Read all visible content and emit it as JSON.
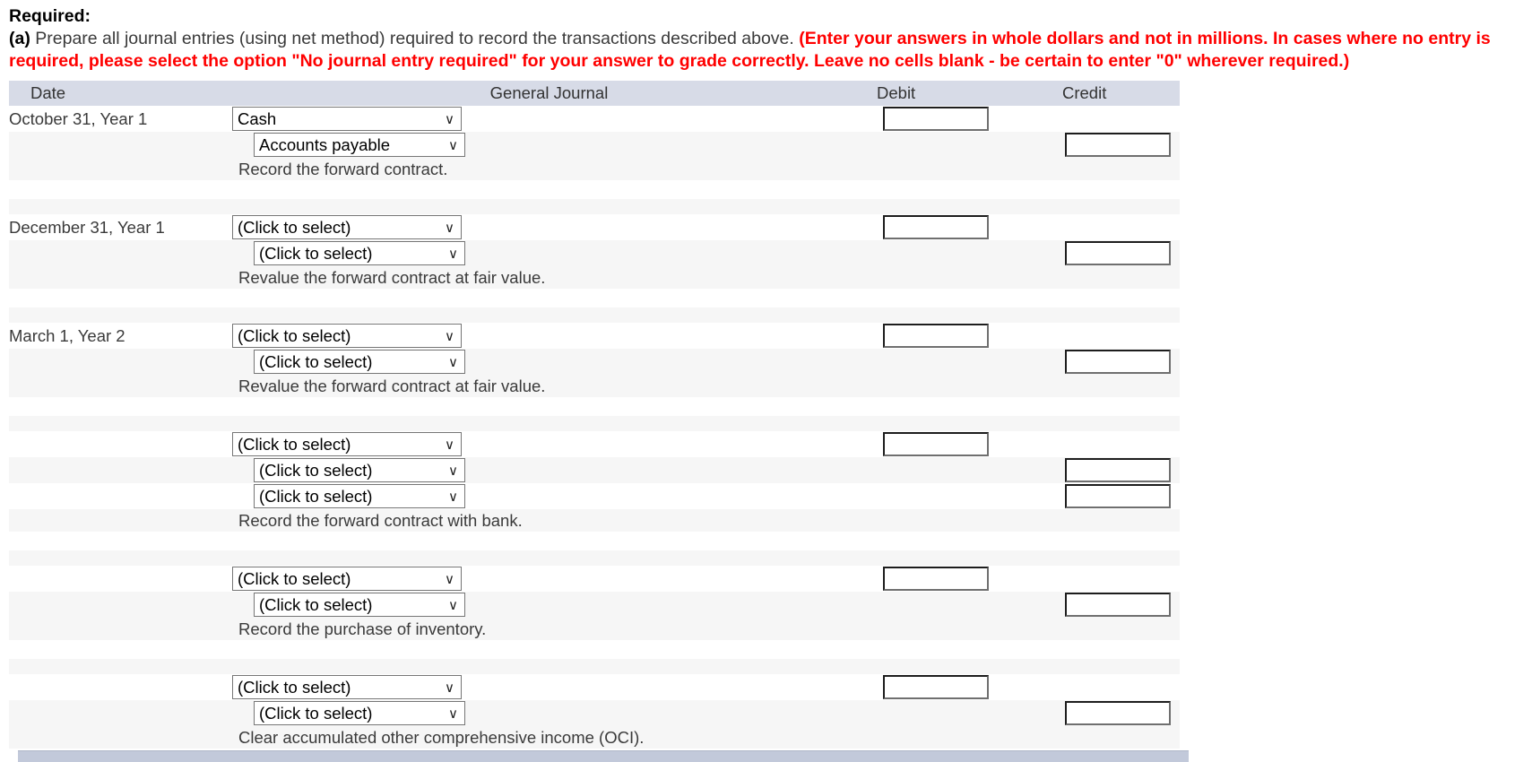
{
  "instructions": {
    "required_title": "Required:",
    "part_label": "(a)",
    "part_text": " Prepare all journal entries (using net method) required to record the transactions described above. ",
    "red_note": "(Enter your answers in whole dollars and not in millions. In cases where no entry is required, please select the option \"No journal entry required\" for your answer to grade correctly. Leave no cells blank - be certain to enter \"0\" wherever required.)"
  },
  "table": {
    "headers": {
      "date": "Date",
      "general_journal": "General Journal",
      "debit": "Debit",
      "credit": "Credit"
    },
    "placeholder_select": "(Click to select)",
    "caret_glyph": "∨",
    "entries": [
      {
        "date": "October 31, Year 1",
        "debit_line": {
          "account": "Cash",
          "amount": ""
        },
        "credit_line": {
          "account": "Accounts payable",
          "amount": ""
        },
        "extra_credit_line": null,
        "memo": "Record the forward contract."
      },
      {
        "date": "December 31, Year 1",
        "debit_line": {
          "account": "(Click to select)",
          "amount": ""
        },
        "credit_line": {
          "account": "(Click to select)",
          "amount": ""
        },
        "extra_credit_line": null,
        "memo": "Revalue the forward contract at fair value."
      },
      {
        "date": "March 1, Year 2",
        "debit_line": {
          "account": "(Click to select)",
          "amount": ""
        },
        "credit_line": {
          "account": "(Click to select)",
          "amount": ""
        },
        "extra_credit_line": null,
        "memo": "Revalue the forward contract at fair value."
      },
      {
        "date": "",
        "debit_line": {
          "account": "(Click to select)",
          "amount": ""
        },
        "credit_line": {
          "account": "(Click to select)",
          "amount": ""
        },
        "extra_credit_line": {
          "account": "(Click to select)",
          "amount": ""
        },
        "memo": "Record the forward contract with bank."
      },
      {
        "date": "",
        "debit_line": {
          "account": "(Click to select)",
          "amount": ""
        },
        "credit_line": {
          "account": "(Click to select)",
          "amount": ""
        },
        "extra_credit_line": null,
        "memo": "Record the purchase of inventory."
      },
      {
        "date": "",
        "debit_line": {
          "account": "(Click to select)",
          "amount": ""
        },
        "credit_line": {
          "account": "(Click to select)",
          "amount": ""
        },
        "extra_credit_line": null,
        "memo": "Clear accumulated other comprehensive income (OCI)."
      }
    ]
  },
  "colors": {
    "header_bg": "#d7dbe7",
    "row_alt_bg": "#f6f6f6",
    "red_text": "#ff0000",
    "footer_bar": "#c2c9da"
  }
}
